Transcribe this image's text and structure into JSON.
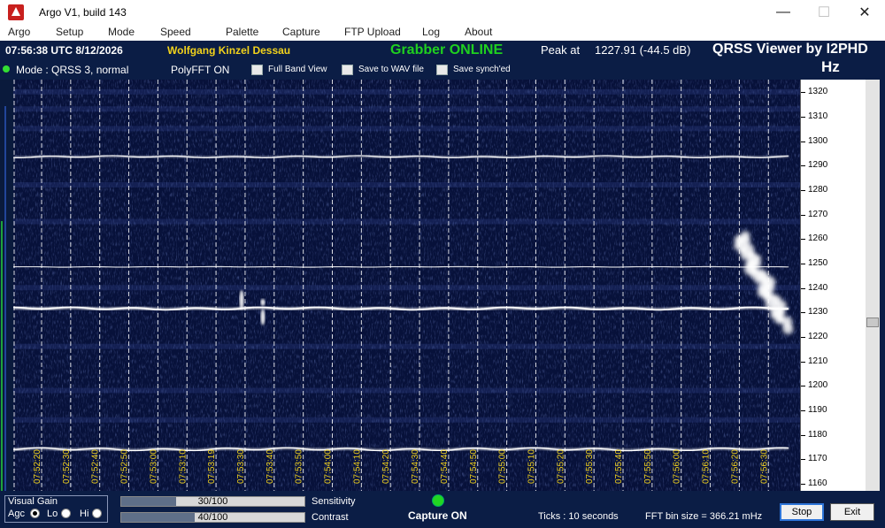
{
  "window": {
    "title": "Argo V1, build 143",
    "minimize_icon": "minimize-icon",
    "maximize_icon": "maximize-icon",
    "close_icon": "close-icon"
  },
  "menu": [
    "Argo",
    "Setup",
    "Mode",
    "Speed",
    "Palette",
    "Capture",
    "FTP Upload",
    "Log",
    "About"
  ],
  "status": {
    "utc": "07:56:38 UTC  8/12/2026",
    "station": "Wolfgang Kinzel Dessau",
    "grabber": "Grabber ONLINE",
    "peak_label": "Peak at",
    "peak_value": "1227.91 (-44.5 dB)",
    "viewer": "QRSS Viewer by I2PHD",
    "unit": "Hz",
    "mode": "Mode : QRSS 3, normal",
    "polyfft": "PolyFFT ON",
    "options": [
      {
        "label": "Full Band View",
        "checked": false
      },
      {
        "label": "Save to WAV file",
        "checked": false
      },
      {
        "label": "Save synch'ed",
        "checked": false
      }
    ]
  },
  "waterfall": {
    "time_labels": [
      "07:52:20",
      "07:52:30",
      "07:52:40",
      "07:52:50",
      "07:53:00",
      "07:53:10",
      "07:53:19",
      "07:53:30",
      "07:53:40",
      "07:53:50",
      "07:54:00",
      "07:54:10",
      "07:54:20",
      "07:54:30",
      "07:54:40",
      "07:54:50",
      "07:55:00",
      "07:55:10",
      "07:55:20",
      "07:55:30",
      "07:55:40",
      "07:55:50",
      "07:56:00",
      "07:56:10",
      "07:56:20",
      "07:56:30"
    ],
    "frequency_scale_hz": [
      1320,
      1310,
      1300,
      1290,
      1280,
      1270,
      1260,
      1250,
      1240,
      1230,
      1220,
      1210,
      1200,
      1190,
      1180,
      1170,
      1160
    ],
    "frequency_range_hz": [
      1155,
      1323
    ],
    "signal_frequencies_hz": [
      1291.5,
      1246.5,
      1229.5,
      1172
    ],
    "colors": {
      "background": "#0b1d45",
      "signal": "#ffffff",
      "grid": "#ffffff"
    }
  },
  "controls": {
    "visual_gain_title": "Visual Gain",
    "gain_options": [
      {
        "label": "Agc",
        "selected": true
      },
      {
        "label": "Lo",
        "selected": false
      },
      {
        "label": "Hi",
        "selected": false
      }
    ],
    "sensitivity": {
      "label": "Sensitivity",
      "value": 30,
      "max": 100,
      "text": "30/100"
    },
    "contrast": {
      "label": "Contrast",
      "value": 40,
      "max": 100,
      "text": "40/100"
    },
    "capture": "Capture ON",
    "ticks": "Ticks  :  10 seconds",
    "fft_bin": "FFT bin size = 366.21 mHz",
    "stop": "Stop",
    "exit": "Exit"
  }
}
